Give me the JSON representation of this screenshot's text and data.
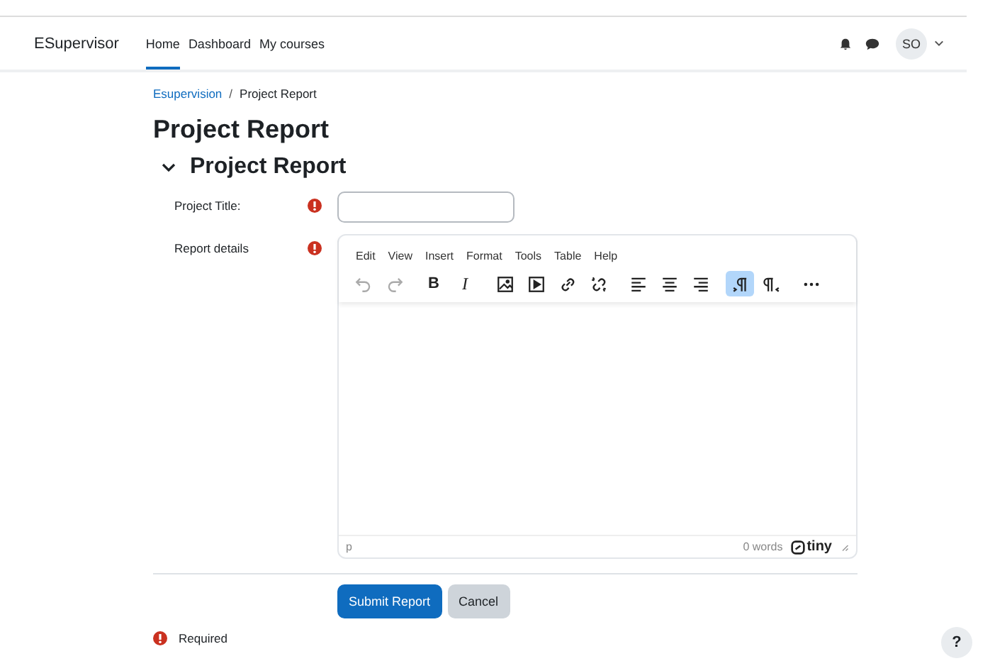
{
  "navbar": {
    "brand": "ESupervisor",
    "links": [
      {
        "label": "Home",
        "selected": true
      },
      {
        "label": "Dashboard",
        "selected": false
      },
      {
        "label": "My courses",
        "selected": false
      }
    ],
    "avatar": "SO"
  },
  "breadcrumb": [
    {
      "label": "Esupervision",
      "kind": "link"
    },
    {
      "label": "Project Report",
      "kind": "current"
    }
  ],
  "breadcrumb_separator": "/",
  "title": "Project Report",
  "section": {
    "title": "Project Report",
    "expanded": true
  },
  "fields": [
    {
      "label": "Project Title:",
      "required": true,
      "kind": "text"
    },
    {
      "label": "Report details",
      "required": true,
      "kind": "editor"
    }
  ],
  "editor": {
    "menu": [
      "Edit",
      "View",
      "Insert",
      "Format",
      "Tools",
      "Table",
      "Help"
    ],
    "toolbar": [
      {
        "kind": "undo",
        "disabled": true,
        "selected": false
      },
      {
        "kind": "redo",
        "disabled": true,
        "selected": false
      },
      {
        "kind": "bold",
        "glyph": "B",
        "disabled": false,
        "selected": false
      },
      {
        "kind": "italic",
        "glyph": "I",
        "disabled": false,
        "selected": false
      },
      {
        "kind": "image",
        "disabled": false,
        "selected": false
      },
      {
        "kind": "media",
        "disabled": false,
        "selected": false
      },
      {
        "kind": "link",
        "disabled": false,
        "selected": false
      },
      {
        "kind": "unlink",
        "disabled": false,
        "selected": false
      },
      {
        "kind": "align-left",
        "disabled": false,
        "selected": false
      },
      {
        "kind": "align-center",
        "disabled": false,
        "selected": false
      },
      {
        "kind": "align-right",
        "disabled": false,
        "selected": false
      },
      {
        "kind": "ltr",
        "disabled": false,
        "selected": true
      },
      {
        "kind": "rtl",
        "disabled": false,
        "selected": false
      },
      {
        "kind": "more",
        "disabled": false,
        "selected": false
      }
    ],
    "path": "p",
    "word_count": "0 words",
    "brand": "tiny"
  },
  "buttons": [
    {
      "label": "Submit Report",
      "kind": "primary"
    },
    {
      "label": "Cancel",
      "kind": "secondary"
    }
  ],
  "required_note": "Required",
  "help": "?"
}
